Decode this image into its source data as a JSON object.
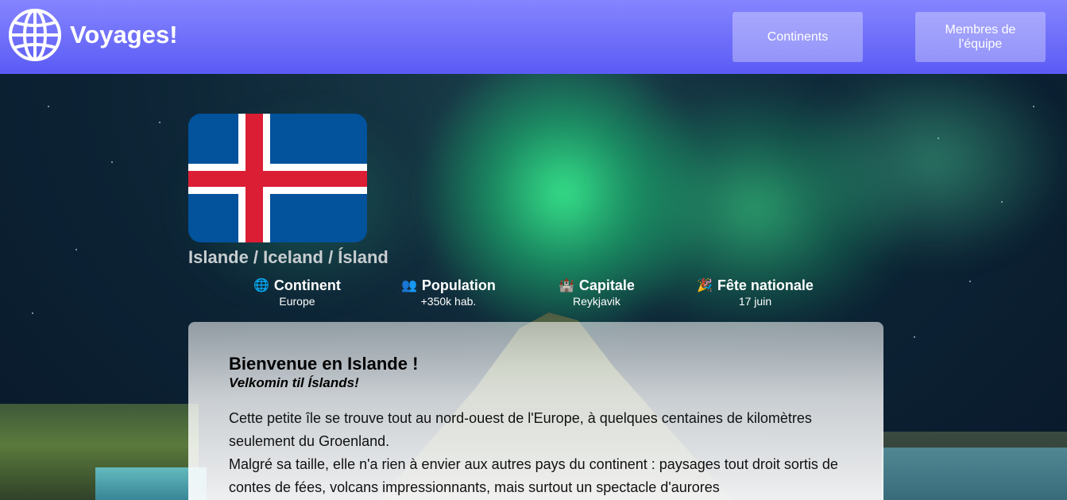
{
  "header": {
    "title": "Voyages!",
    "logo_icon": "globe-icon",
    "nav": [
      {
        "label": "Continents"
      },
      {
        "label": "Membres de l'équipe"
      }
    ]
  },
  "country": {
    "name": "Islande / Iceland / Ísland",
    "flag_colors": {
      "blue": "#02529c",
      "white": "#ffffff",
      "red": "#dc1e35"
    }
  },
  "facts": [
    {
      "icon": "🌐",
      "icon_name": "globe-icon",
      "label": "Continent",
      "value": "Europe"
    },
    {
      "icon": "👥",
      "icon_name": "people-icon",
      "label": "Population",
      "value": "+350k hab."
    },
    {
      "icon": "🏰",
      "icon_name": "castle-icon",
      "label": "Capitale",
      "value": "Reykjavik"
    },
    {
      "icon": "🎉",
      "icon_name": "party-popper-icon",
      "label": "Fête nationale",
      "value": "17 juin"
    }
  ],
  "content": {
    "heading": "Bienvenue en Islande !",
    "subheading": "Velkomin til Íslands!",
    "paragraph1": "Cette petite île se trouve tout au nord-ouest de l'Europe, à quelques centaines de kilomètres seulement du Groenland.",
    "paragraph2": "Malgré sa taille, elle n'a rien à envier aux autres pays du continent : paysages tout droit sortis de contes de fées, volcans impressionnants, mais surtout un spectacle d'aurores"
  },
  "colors": {
    "header_top": "#8585ff",
    "header_bottom": "#5b5bf5",
    "aurora": "#3cff96"
  }
}
